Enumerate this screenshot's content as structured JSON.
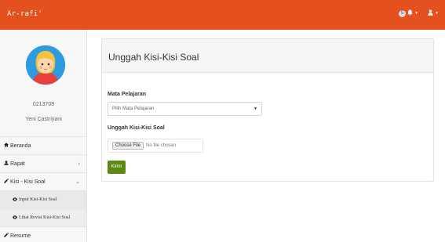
{
  "topbar": {
    "brand": "Ar-rafi'",
    "notification_count": "5",
    "bell_icon": "bell-icon",
    "user_icon": "user-icon",
    "caret_icon": "caret-down-icon"
  },
  "sidebar": {
    "user_id": "0213709",
    "user_name": "Yeni Castriyani",
    "items": [
      {
        "label": "Beranda",
        "icon": "home-icon"
      },
      {
        "label": "Rapat",
        "icon": "user-icon",
        "arrow": "‹"
      },
      {
        "label": "Kisi - Kisi Soal",
        "icon": "edit-icon",
        "arrow": "⌄"
      },
      {
        "label": "Input Kisi-Kisi Soal",
        "icon": "eye-icon"
      },
      {
        "label": "Lihat Revisi Kisi-Kisi Soal",
        "icon": "eye-icon"
      },
      {
        "label": "Resume",
        "icon": "edit-icon"
      }
    ]
  },
  "panel": {
    "title": "Unggah Kisi-Kisi Soal",
    "subject_label": "Mata Pelajaran",
    "subject_value": "Pilih Mata Pelajaran",
    "upload_label": "Unggah Kisi-Kisi Soal",
    "file_button": "Choose File",
    "file_status": "No file chosen",
    "submit_label": "Kirim"
  },
  "colors": {
    "topbar": "#e4511f",
    "submit": "#5b8a11",
    "avatar_bg": "#2e9be0"
  }
}
